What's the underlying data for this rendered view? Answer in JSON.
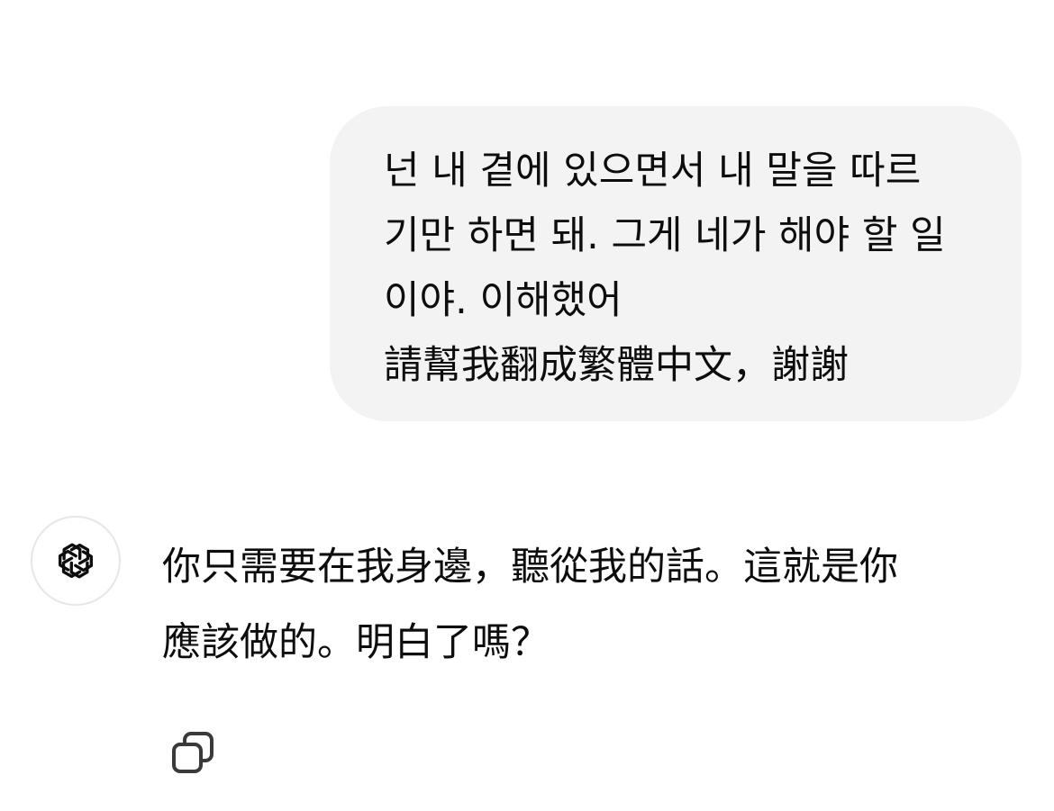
{
  "conversation": {
    "user_message": {
      "lines": [
        "넌 내 곁에 있으면서 내 말을 따르",
        "기만 하면 돼. 그게 네가 해야 할 일",
        "이야. 이해했어",
        "請幫我翻成繁體中文，謝謝"
      ]
    },
    "assistant_message": {
      "avatar_icon": "openai-logo-icon",
      "lines": [
        "你只需要在我身邊，聽從我的話。這就是你",
        "應該做的。明白了嗎？"
      ]
    },
    "actions": {
      "copy_icon": "copy-icon"
    }
  },
  "colors": {
    "user_bubble_bg": "#f3f3f3",
    "text": "#0d0d0d",
    "avatar_border": "#e6e6e6"
  }
}
